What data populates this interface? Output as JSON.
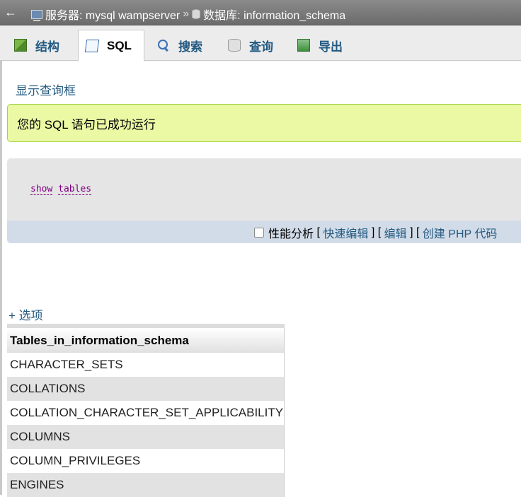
{
  "topbar": {
    "back": "←",
    "server_label": "服务器: mysql wampserver",
    "separator": "»",
    "database_label": "数据库: information_schema"
  },
  "tabs": [
    {
      "label": "结构"
    },
    {
      "label": "SQL"
    },
    {
      "label": "搜索"
    },
    {
      "label": "查询"
    },
    {
      "label": "导出"
    }
  ],
  "show_query_box": "显示查询框",
  "success_message": "您的 SQL 语句已成功运行",
  "sql": {
    "kw1": "show",
    "kw2": "tables"
  },
  "tools": {
    "profiling": "性能分析",
    "quick_edit": "快速编辑",
    "edit": "编辑",
    "create_php": "创建 PHP 代码"
  },
  "options_link": "+ 选项",
  "result": {
    "header": "Tables_in_information_schema",
    "rows": [
      "CHARACTER_SETS",
      "COLLATIONS",
      "COLLATION_CHARACTER_SET_APPLICABILITY",
      "COLUMNS",
      "COLUMN_PRIVILEGES",
      "ENGINES"
    ]
  },
  "colors": {
    "link": "#235a81",
    "success_bg": "#ebf8a4",
    "success_border": "#a2d246",
    "sql_keyword": "#800080"
  }
}
